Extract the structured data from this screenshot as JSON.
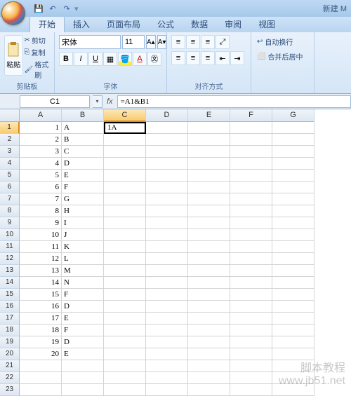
{
  "title": "新建 M",
  "qat": {
    "save": "💾",
    "undo": "↶",
    "redo": "↷"
  },
  "tabs": [
    "开始",
    "插入",
    "页面布局",
    "公式",
    "数据",
    "审阅",
    "视图"
  ],
  "active_tab": 0,
  "clipboard": {
    "paste": "粘贴",
    "cut": "剪切",
    "copy": "复制",
    "format": "格式刷",
    "label": "剪贴板"
  },
  "font": {
    "name": "宋体",
    "size": "11",
    "label": "字体"
  },
  "align": {
    "wrap": "自动换行",
    "merge": "合并后居中",
    "label": "对齐方式"
  },
  "namebox": "C1",
  "formula": "=A1&B1",
  "columns": [
    "A",
    "B",
    "C",
    "D",
    "E",
    "F",
    "G"
  ],
  "active_col_idx": 2,
  "active_row": 1,
  "active_cell_value": "1A",
  "rows": [
    {
      "n": 1,
      "a": "1",
      "b": "A"
    },
    {
      "n": 2,
      "a": "2",
      "b": "B"
    },
    {
      "n": 3,
      "a": "3",
      "b": "C"
    },
    {
      "n": 4,
      "a": "4",
      "b": "D"
    },
    {
      "n": 5,
      "a": "5",
      "b": "E"
    },
    {
      "n": 6,
      "a": "6",
      "b": "F"
    },
    {
      "n": 7,
      "a": "7",
      "b": "G"
    },
    {
      "n": 8,
      "a": "8",
      "b": "H"
    },
    {
      "n": 9,
      "a": "9",
      "b": "I"
    },
    {
      "n": 10,
      "a": "10",
      "b": "J"
    },
    {
      "n": 11,
      "a": "11",
      "b": "K"
    },
    {
      "n": 12,
      "a": "12",
      "b": "L"
    },
    {
      "n": 13,
      "a": "13",
      "b": "M"
    },
    {
      "n": 14,
      "a": "14",
      "b": "N"
    },
    {
      "n": 15,
      "a": "15",
      "b": "F"
    },
    {
      "n": 16,
      "a": "16",
      "b": "D"
    },
    {
      "n": 17,
      "a": "17",
      "b": "E"
    },
    {
      "n": 18,
      "a": "18",
      "b": "F"
    },
    {
      "n": 19,
      "a": "19",
      "b": "D"
    },
    {
      "n": 20,
      "a": "20",
      "b": "E"
    },
    {
      "n": 21,
      "a": "",
      "b": ""
    },
    {
      "n": 22,
      "a": "",
      "b": ""
    },
    {
      "n": 23,
      "a": "",
      "b": ""
    }
  ],
  "watermark": {
    "l1": "脚本教程",
    "l2": "www.jb51.net"
  }
}
